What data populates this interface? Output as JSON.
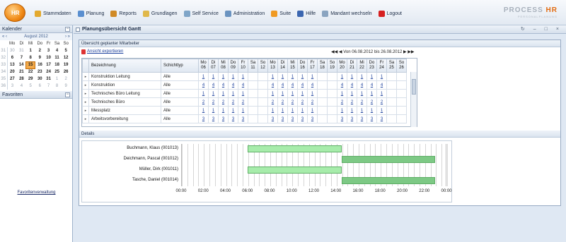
{
  "app": {
    "logo_text": "HR",
    "brand_name": "PROCESS",
    "brand_suffix": "HR",
    "brand_tagline": "PERSONALPLANUNG"
  },
  "menu": [
    {
      "label": "Stammdaten",
      "icon": "folder-icon",
      "color": "#e3a92e"
    },
    {
      "label": "Planung",
      "icon": "planning-icon",
      "color": "#5a8fd0"
    },
    {
      "label": "Reports",
      "icon": "chart-icon",
      "color": "#d08a26"
    },
    {
      "label": "Grundlagen",
      "icon": "wrench-icon",
      "color": "#e0b84a"
    },
    {
      "label": "Self Service",
      "icon": "people-icon",
      "color": "#7fa5c8"
    },
    {
      "label": "Administration",
      "icon": "admin-icon",
      "color": "#6a93c0"
    },
    {
      "label": "Suite",
      "icon": "suite-icon",
      "color": "#f09a22"
    },
    {
      "label": "Hilfe",
      "icon": "help-icon",
      "color": "#3b66b0"
    },
    {
      "label": "Mandant wechseln",
      "icon": "switch-icon",
      "color": "#8aa4c0"
    },
    {
      "label": "Logout",
      "icon": "logout-icon",
      "color": "#d62020"
    }
  ],
  "sidebar": {
    "calendar_title": "Kalender",
    "month_label": "August 2012",
    "nav_prev": "« ‹",
    "nav_next": "› »",
    "weekdays": [
      "Mo",
      "Di",
      "Mi",
      "Do",
      "Fr",
      "Sa",
      "So"
    ],
    "weeks": [
      {
        "wk": "31",
        "days": [
          "30",
          "31",
          "1",
          "2",
          "3",
          "4",
          "5"
        ]
      },
      {
        "wk": "32",
        "days": [
          "6",
          "7",
          "8",
          "9",
          "10",
          "11",
          "12"
        ]
      },
      {
        "wk": "33",
        "days": [
          "13",
          "14",
          "15",
          "16",
          "17",
          "18",
          "19"
        ]
      },
      {
        "wk": "34",
        "days": [
          "20",
          "21",
          "22",
          "23",
          "24",
          "25",
          "26"
        ]
      },
      {
        "wk": "35",
        "days": [
          "27",
          "28",
          "29",
          "30",
          "31",
          "1",
          "2"
        ]
      },
      {
        "wk": "36",
        "days": [
          "3",
          "4",
          "5",
          "6",
          "7",
          "8",
          "9"
        ]
      }
    ],
    "today": "15",
    "favorites_title": "Favoriten",
    "favorites_link": "Favoritenverwaltung"
  },
  "main": {
    "title": "Planungsübersicht Gantt",
    "window_controls": [
      "↻",
      "–",
      "□",
      "×"
    ],
    "section_title": "Übersicht geplanter Mitarbeiter",
    "export_label": "Ansicht exportieren",
    "date_range_prefix": "Von",
    "date_from": "06.08.2012",
    "date_range_mid": "bis",
    "date_to": "26.08.2012",
    "table": {
      "col_name": "Bezeichnung",
      "col_type": "Schichttyp",
      "day_headers": [
        [
          "Mo",
          "06"
        ],
        [
          "Di",
          "07"
        ],
        [
          "Mi",
          "08"
        ],
        [
          "Do",
          "09"
        ],
        [
          "Fr",
          "10"
        ],
        [
          "Sa",
          "11"
        ],
        [
          "So",
          "12"
        ],
        [
          "Mo",
          "13"
        ],
        [
          "Di",
          "14"
        ],
        [
          "Mi",
          "15"
        ],
        [
          "Do",
          "16"
        ],
        [
          "Fr",
          "17"
        ],
        [
          "Sa",
          "18"
        ],
        [
          "So",
          "19"
        ],
        [
          "Mo",
          "20"
        ],
        [
          "Di",
          "21"
        ],
        [
          "Mi",
          "22"
        ],
        [
          "Do",
          "23"
        ],
        [
          "Fr",
          "24"
        ],
        [
          "Sa",
          "25"
        ],
        [
          "So",
          "26"
        ]
      ],
      "rows": [
        {
          "name": "Konstruktion Leitung",
          "type": "Alle",
          "values": [
            "1",
            "1",
            "1",
            "1",
            "1",
            "",
            "",
            "1",
            "1",
            "1",
            "1",
            "1",
            "",
            "",
            "1",
            "1",
            "1",
            "1",
            "1",
            "",
            ""
          ]
        },
        {
          "name": "Konstruktion",
          "type": "Alle",
          "values": [
            "4",
            "4",
            "4",
            "4",
            "4",
            "",
            "",
            "4",
            "4",
            "4",
            "4",
            "4",
            "",
            "",
            "4",
            "4",
            "4",
            "4",
            "4",
            "",
            ""
          ]
        },
        {
          "name": "Technisches Büro Leitung",
          "type": "Alle",
          "values": [
            "1",
            "1",
            "1",
            "1",
            "1",
            "",
            "",
            "1",
            "1",
            "1",
            "1",
            "1",
            "",
            "",
            "1",
            "1",
            "1",
            "1",
            "1",
            "",
            ""
          ]
        },
        {
          "name": "Technisches Büro",
          "type": "Alle",
          "values": [
            "2",
            "2",
            "2",
            "2",
            "2",
            "",
            "",
            "2",
            "2",
            "2",
            "2",
            "2",
            "",
            "",
            "2",
            "2",
            "2",
            "2",
            "2",
            "",
            ""
          ]
        },
        {
          "name": "Messplatz",
          "type": "Alle",
          "values": [
            "1",
            "1",
            "1",
            "1",
            "1",
            "",
            "",
            "1",
            "1",
            "1",
            "1",
            "1",
            "",
            "",
            "1",
            "1",
            "1",
            "1",
            "1",
            "",
            ""
          ]
        },
        {
          "name": "Arbeitsvorbereitung",
          "type": "Alle",
          "values": [
            "3",
            "3",
            "3",
            "3",
            "3",
            "",
            "",
            "3",
            "3",
            "3",
            "3",
            "3",
            "",
            "",
            "3",
            "3",
            "3",
            "3",
            "3",
            "",
            ""
          ]
        }
      ]
    },
    "details_title": "Details",
    "gantt": {
      "time_labels": [
        "00:00",
        "02:00",
        "04:00",
        "06:00",
        "08:00",
        "10:00",
        "12:00",
        "14:00",
        "16:00",
        "18:00",
        "20:00",
        "22:00",
        "00:00"
      ],
      "rows": [
        {
          "name": "Buchmann, Klaus (001013)",
          "bars": [
            {
              "start": 6,
              "end": 14.5,
              "color": "#a7ecab"
            }
          ]
        },
        {
          "name": "Deichmann, Pascal (001012)",
          "bars": [
            {
              "start": 14.5,
              "end": 23,
              "color": "#7dc985"
            }
          ]
        },
        {
          "name": "Müller, Dirk (001011)",
          "bars": [
            {
              "start": 6,
              "end": 14.5,
              "color": "#a7ecab"
            }
          ]
        },
        {
          "name": "Tasche, Daniel (001014)",
          "bars": [
            {
              "start": 14.5,
              "end": 23,
              "color": "#7dc985"
            }
          ]
        }
      ]
    }
  }
}
